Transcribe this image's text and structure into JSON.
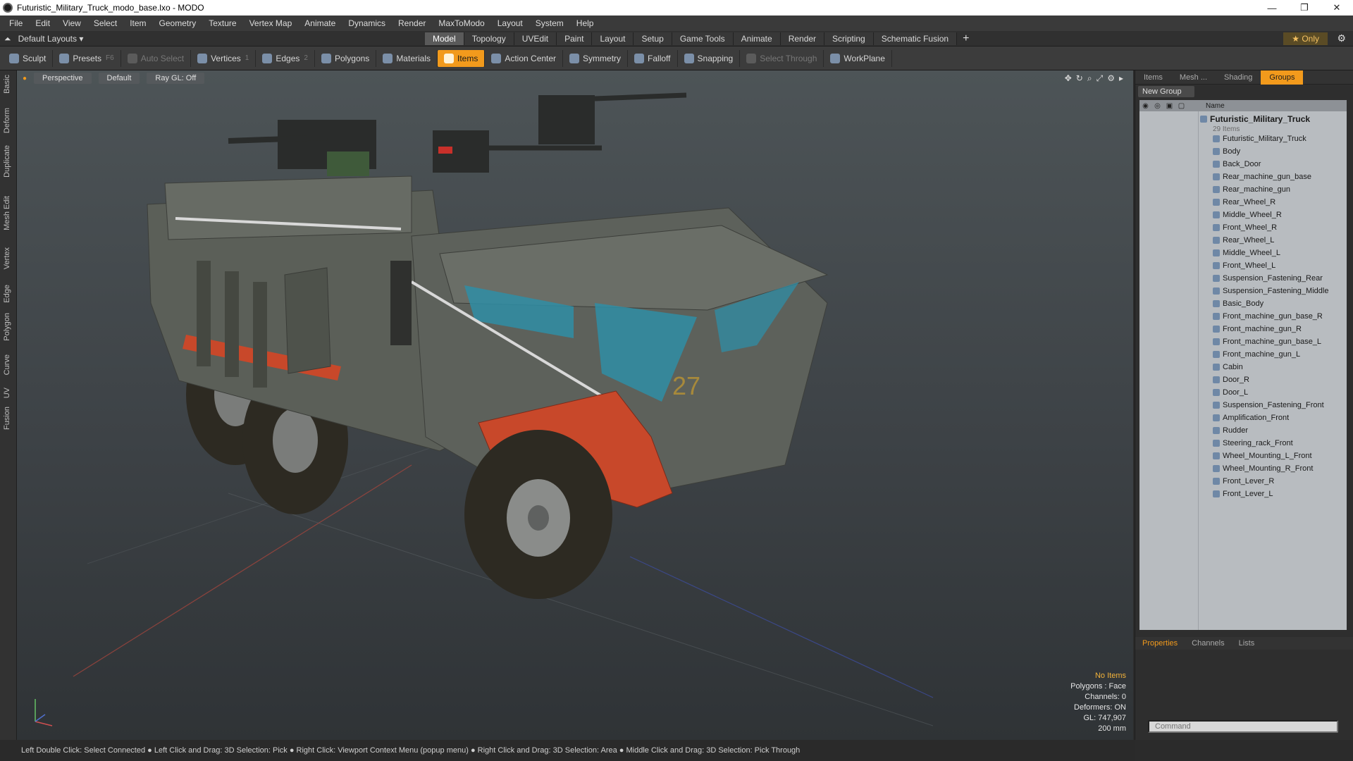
{
  "window": {
    "title": "Futuristic_Military_Truck_modo_base.lxo - MODO",
    "minimize": "—",
    "maximize": "❐",
    "close": "✕"
  },
  "menu": [
    "File",
    "Edit",
    "View",
    "Select",
    "Item",
    "Geometry",
    "Texture",
    "Vertex Map",
    "Animate",
    "Dynamics",
    "Render",
    "MaxToModo",
    "Layout",
    "System",
    "Help"
  ],
  "layouts": {
    "label": "Default Layouts ▾"
  },
  "tabs": [
    "Model",
    "Topology",
    "UVEdit",
    "Paint",
    "Layout",
    "Setup",
    "Game Tools",
    "Animate",
    "Render",
    "Scripting",
    "Schematic Fusion"
  ],
  "active_tab": "Model",
  "only_button": "★ Only",
  "toolbar": {
    "sculpt": "Sculpt",
    "presets": "Presets",
    "presets_hotkey": "F6",
    "auto_select": "Auto Select",
    "vertices": "Vertices",
    "vertices_count": "1",
    "edges": "Edges",
    "edges_count": "2",
    "polygons": "Polygons",
    "materials": "Materials",
    "items": "Items",
    "action_center": "Action Center",
    "symmetry": "Symmetry",
    "falloff": "Falloff",
    "snapping": "Snapping",
    "select_through": "Select Through",
    "workplane": "WorkPlane"
  },
  "left_strip": [
    "Basic",
    "Deform",
    "Duplicate",
    "Mesh Edit",
    "Vertex",
    "Edge",
    "Polygon",
    "Curve",
    "UV",
    "Fusion"
  ],
  "viewport": {
    "projection": "Perspective",
    "shading": "Default",
    "raygl": "Ray GL: Off",
    "stats": {
      "selection": "No Items",
      "polygons": "Polygons : Face",
      "channels": "Channels: 0",
      "deformers": "Deformers: ON",
      "gl": "GL: 747,907",
      "scale": "200 mm"
    }
  },
  "right_panel": {
    "tabs": [
      "Items",
      "Mesh ...",
      "Shading",
      "Groups"
    ],
    "active_tab": "Groups",
    "new_group": "New Group",
    "name_header": "Name",
    "group_name": "Futuristic_Military_Truck",
    "group_count": "29 Items",
    "items": [
      "Futuristic_Military_Truck",
      "Body",
      "Back_Door",
      "Rear_machine_gun_base",
      "Rear_machine_gun",
      "Rear_Wheel_R",
      "Middle_Wheel_R",
      "Front_Wheel_R",
      "Rear_Wheel_L",
      "Middle_Wheel_L",
      "Front_Wheel_L",
      "Suspension_Fastening_Rear",
      "Suspension_Fastening_Middle",
      "Basic_Body",
      "Front_machine_gun_base_R",
      "Front_machine_gun_R",
      "Front_machine_gun_base_L",
      "Front_machine_gun_L",
      "Cabin",
      "Door_R",
      "Door_L",
      "Suspension_Fastening_Front",
      "Amplification_Front",
      "Rudder",
      "Steering_rack_Front",
      "Wheel_Mounting_L_Front",
      "Wheel_Mounting_R_Front",
      "Front_Lever_R",
      "Front_Lever_L"
    ],
    "bottom_tabs": [
      "Properties",
      "Channels",
      "Lists"
    ],
    "bottom_active": "Properties",
    "command_placeholder": "Command"
  },
  "statusbar": "Left Double Click: Select Connected ● Left Click and Drag: 3D Selection: Pick ● Right Click: Viewport Context Menu (popup menu) ● Right Click and Drag: 3D Selection: Area ● Middle Click and Drag: 3D Selection: Pick Through",
  "colors": {
    "accent": "#f29a1c",
    "truck_body": "#5b5f58",
    "truck_red": "#c8482a",
    "glass": "#2f8ea6"
  }
}
